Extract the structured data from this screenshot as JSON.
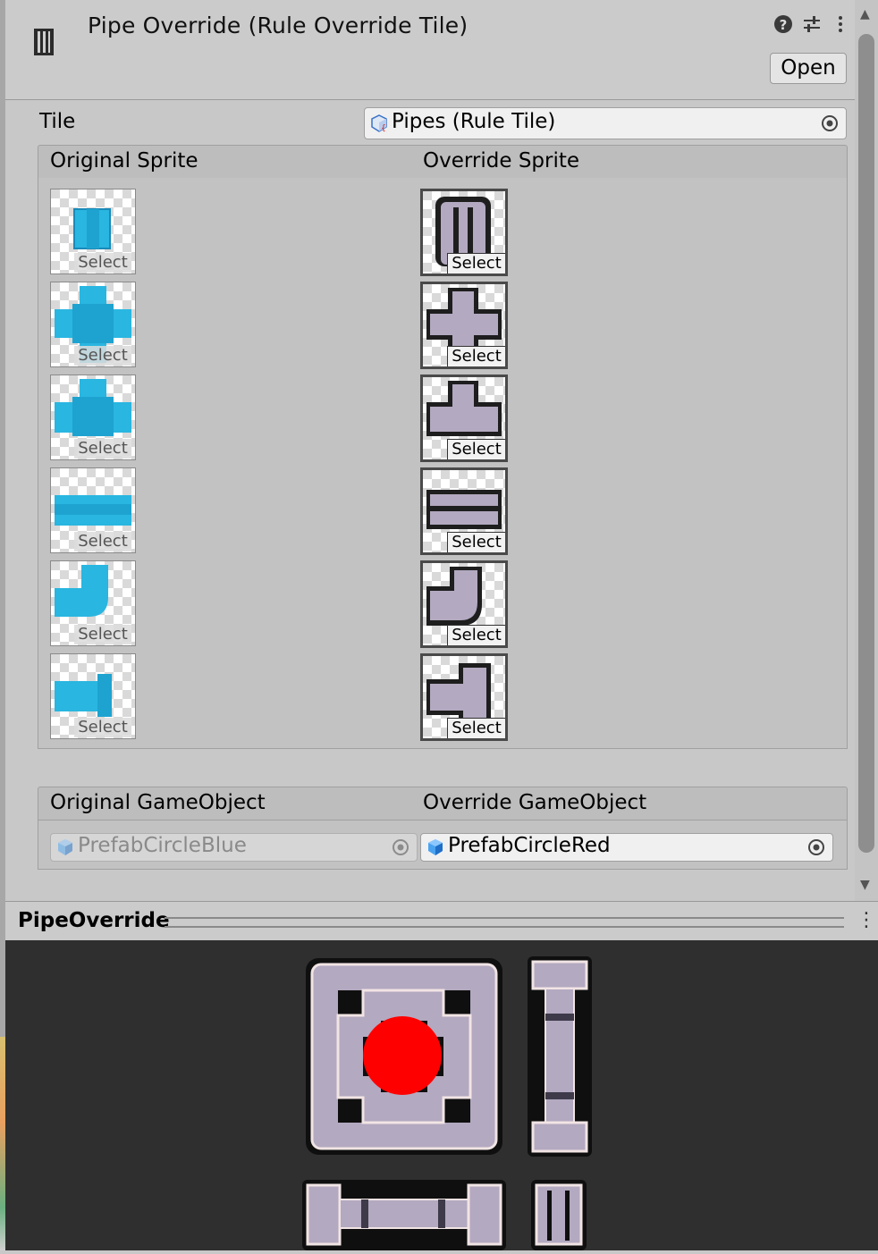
{
  "header": {
    "title": "Pipe Override (Rule Override Tile)",
    "open_label": "Open",
    "help_icon": "help-icon",
    "presets_icon": "presets-sliders-icon",
    "menu_icon": "kebab-menu-icon"
  },
  "tile": {
    "label": "Tile",
    "value": "Pipes (Rule Tile)"
  },
  "sprites": {
    "original_header": "Original Sprite",
    "override_header": "Override Sprite",
    "select_label": "Select",
    "rows": [
      {
        "original": "pipe-cap-blue",
        "override": "pipe-cap-gray"
      },
      {
        "original": "pipe-cross-blue",
        "override": "pipe-cross-gray"
      },
      {
        "original": "pipe-tee-blue",
        "override": "pipe-tee-gray"
      },
      {
        "original": "pipe-straight-blue",
        "override": "pipe-straight-gray"
      },
      {
        "original": "pipe-elbow-blue",
        "override": "pipe-elbow-gray"
      },
      {
        "original": "pipe-end-blue",
        "override": "pipe-end-gray"
      }
    ]
  },
  "gameobjects": {
    "original_header": "Original GameObject",
    "override_header": "Override GameObject",
    "original_value": "PrefabCircleBlue",
    "override_value": "PrefabCircleRed"
  },
  "preview": {
    "title": "PipeOverride"
  },
  "colors": {
    "blue_pipe": "#29b6e0",
    "gray_pipe": "#b3a9c0",
    "red_circle": "#ff0000",
    "preview_bg": "#2f2f2f"
  }
}
